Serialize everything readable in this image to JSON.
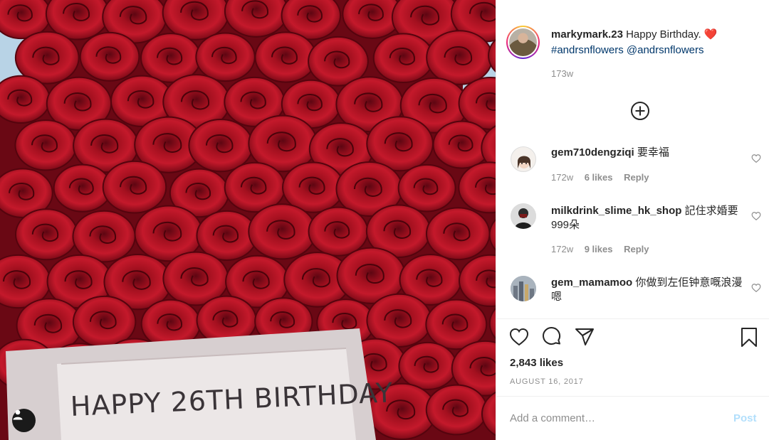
{
  "photo": {
    "tag_text": "HAPPY 26TH BIRTHDAY"
  },
  "post": {
    "author": "markymark.23",
    "caption_text": "Happy Birthday.",
    "caption_emoji": "❤️",
    "hashtag": "#andrsnflowers",
    "mention": "@andrsnflowers",
    "time_ago": "173w"
  },
  "comments": [
    {
      "username": "gem710dengziqi",
      "text": "要幸福",
      "time": "172w",
      "likes": "6 likes",
      "reply": "Reply"
    },
    {
      "username": "milkdrink_slime_hk_shop",
      "text": "記住求婚要999朵",
      "time": "172w",
      "likes": "9 likes",
      "reply": "Reply"
    },
    {
      "username": "gem_mamamoo",
      "text": "你做到左佢钟意嘅浪漫 嗯"
    }
  ],
  "engagement": {
    "likes": "2,843 likes",
    "date": "AUGUST 16, 2017"
  },
  "comment_box": {
    "placeholder": "Add a comment…",
    "post_label": "Post"
  },
  "colors": {
    "link": "#00376b",
    "post_button": "#b2dffc",
    "heart": "#e0302f",
    "rose": "#a3101f"
  },
  "icons": [
    "plus-circle-icon",
    "heart-icon",
    "comment-icon",
    "share-icon",
    "bookmark-icon",
    "user-tag-icon"
  ]
}
